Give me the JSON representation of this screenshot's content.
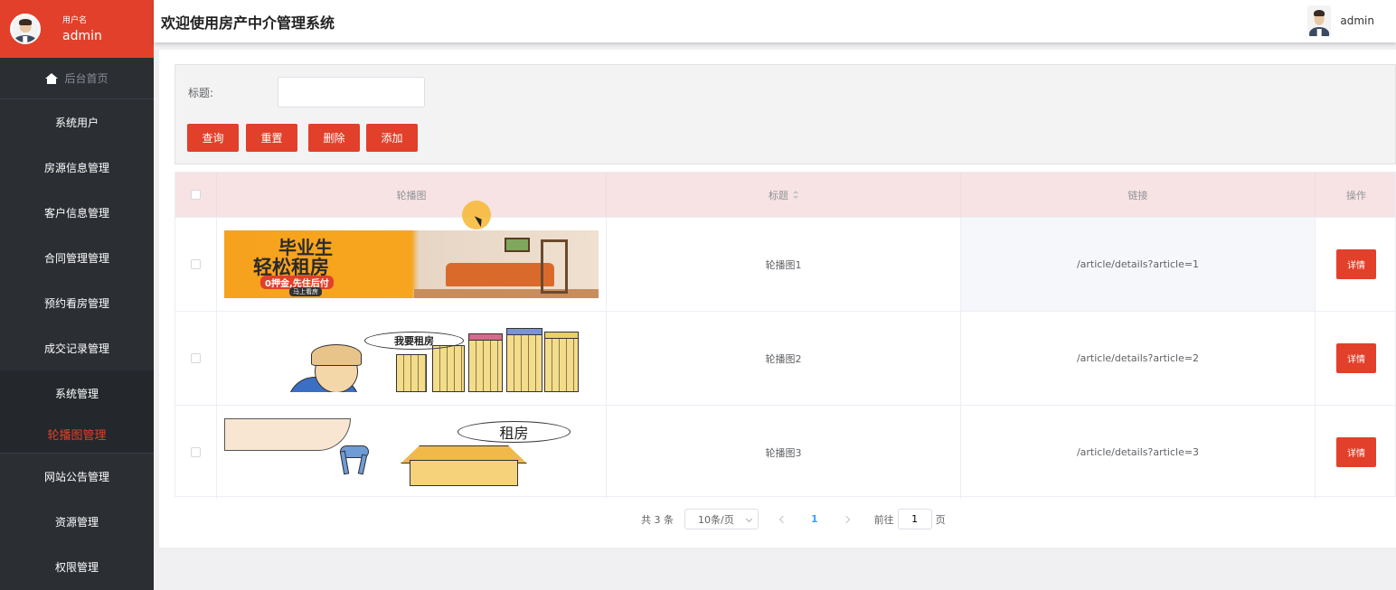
{
  "sidebar": {
    "user_role": "用户名",
    "user_name": "admin",
    "home": "后台首页",
    "items": [
      {
        "label": "系统用户"
      },
      {
        "label": "房源信息管理"
      },
      {
        "label": "客户信息管理"
      },
      {
        "label": "合同管理管理"
      },
      {
        "label": "预约看房管理"
      },
      {
        "label": "成交记录管理"
      },
      {
        "label": "系统管理"
      },
      {
        "label": "轮播图管理"
      },
      {
        "label": "网站公告管理"
      },
      {
        "label": "资源管理"
      },
      {
        "label": "权限管理"
      }
    ]
  },
  "header": {
    "title": "欢迎使用房产中介管理系统",
    "user": "admin"
  },
  "filter": {
    "title_label": "标题:",
    "title_value": "",
    "buttons": {
      "query": "查询",
      "reset": "重置",
      "delete": "删除",
      "add": "添加"
    }
  },
  "table": {
    "columns": {
      "image": "轮播图",
      "title": "标题",
      "link": "链接",
      "actions": "操作"
    },
    "rows": [
      {
        "title": "轮播图1",
        "link": "/article/details?article=1",
        "action": "详情",
        "banner_text": [
          "毕业生",
          "轻松租房",
          "0押金,先住后付",
          "马上看房"
        ]
      },
      {
        "title": "轮播图2",
        "link": "/article/details?article=2",
        "action": "详情",
        "banner_text": [
          "我要租房"
        ]
      },
      {
        "title": "轮播图3",
        "link": "/article/details?article=3",
        "action": "详情",
        "banner_text": [
          "租房"
        ]
      }
    ]
  },
  "pagination": {
    "total": "共 3 条",
    "page_size": "10条/页",
    "current_page": "1",
    "goto_label": "前往",
    "goto_value": "1",
    "page_unit": "页"
  },
  "colors": {
    "accent": "#e2402a",
    "sidebar_bg": "#2b2e33",
    "header_row_bg": "#f7e3e3"
  }
}
